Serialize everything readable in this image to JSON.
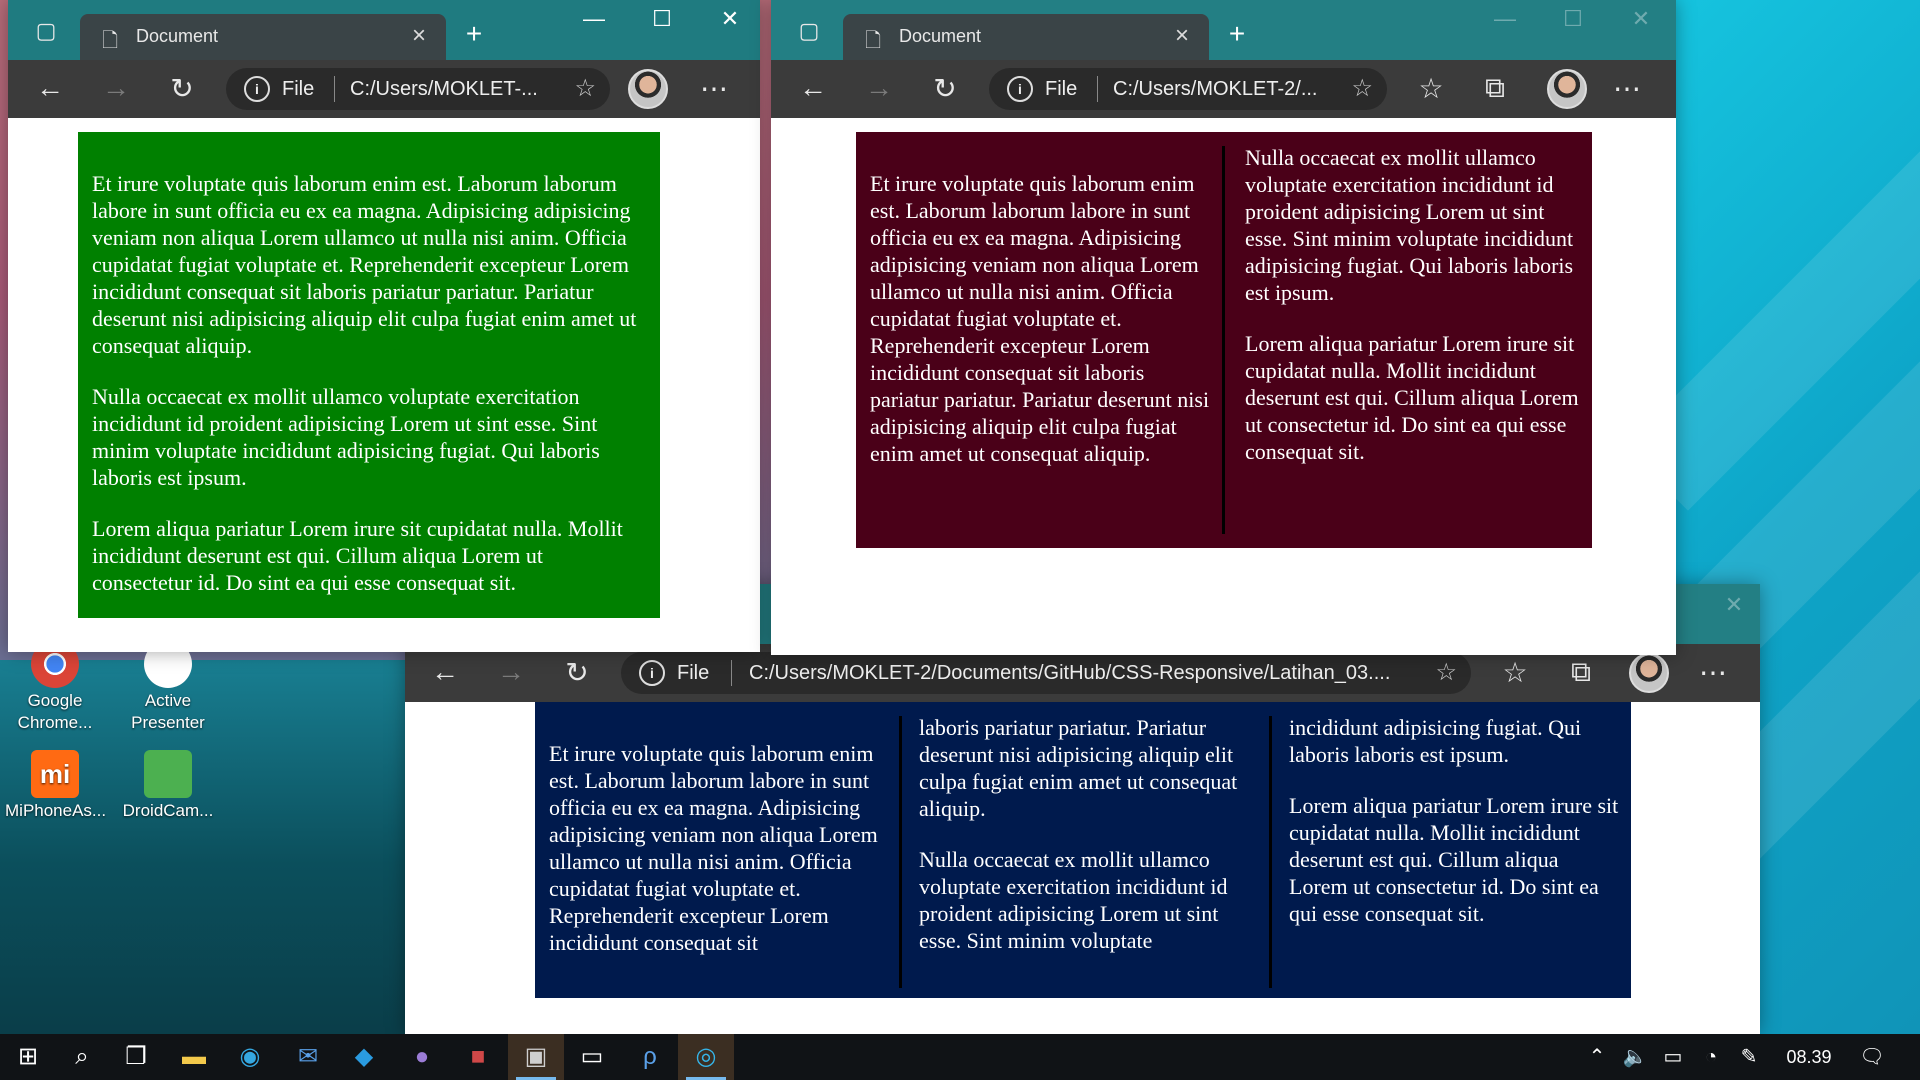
{
  "desktop": {
    "icons": [
      {
        "label": "Google Chrome...",
        "icon": "chrome-shortcut-icon"
      },
      {
        "label": "Active Presenter",
        "icon": "activepresenter-icon"
      },
      {
        "label": "MiPhoneAs...",
        "icon": "mi-icon",
        "color": "#ff6a13"
      },
      {
        "label": "DroidCam...",
        "icon": "droidcam-icon",
        "color": "#4cb050"
      }
    ]
  },
  "windows": [
    {
      "tab_title": "Document",
      "address": {
        "scheme_label": "File",
        "url": "C:/Users/MOKLET-..."
      },
      "box_color": "#008000",
      "paragraphs": [
        "Et irure voluptate quis laborum enim est. Laborum laborum labore in sunt officia eu ex ea magna. Adipisicing adipisicing veniam non aliqua Lorem ullamco ut nulla nisi anim. Officia cupidatat fugiat voluptate et. Reprehenderit excepteur Lorem incididunt consequat sit laboris pariatur pariatur. Pariatur deserunt nisi adipisicing aliquip elit culpa fugiat enim amet ut consequat aliquip.",
        "Nulla occaecat ex mollit ullamco voluptate exercitation incididunt id proident adipisicing Lorem ut sint esse. Sint minim voluptate incididunt adipisicing fugiat. Qui laboris laboris est ipsum.",
        "Lorem aliqua pariatur Lorem irure sit cupidatat nulla. Mollit incididunt deserunt est qui. Cillum aliqua Lorem ut consectetur id. Do sint ea qui esse consequat sit."
      ]
    },
    {
      "tab_title": "Document",
      "address": {
        "scheme_label": "File",
        "url": "C:/Users/MOKLET-2/..."
      },
      "box_color": "#4a0018",
      "columns": [
        [
          "Et irure voluptate quis laborum enim est. Laborum laborum labore in sunt officia eu ex ea magna. Adipisicing adipisicing veniam non aliqua Lorem ullamco ut nulla nisi anim. Officia cupidatat fugiat voluptate et. Reprehenderit excepteur Lorem incididunt consequat sit laboris pariatur pariatur. Pariatur deserunt nisi adipisicing aliquip elit culpa fugiat enim amet ut consequat aliquip."
        ],
        [
          "Nulla occaecat ex mollit ullamco voluptate exercitation incididunt id proident adipisicing Lorem ut sint esse. Sint minim voluptate incididunt adipisicing fugiat. Qui laboris laboris est ipsum.",
          "Lorem aliqua pariatur Lorem irure sit cupidatat nulla. Mollit incididunt deserunt est qui. Cillum aliqua Lorem ut consectetur id. Do sint ea qui esse consequat sit."
        ]
      ]
    },
    {
      "address": {
        "scheme_label": "File",
        "url": "C:/Users/MOKLET-2/Documents/GitHub/CSS-Responsive/Latihan_03...."
      },
      "box_color": "#001a4d",
      "columns": [
        [
          "Et irure voluptate quis laborum enim est. Laborum laborum labore in sunt officia eu ex ea magna. Adipisicing adipisicing veniam non aliqua Lorem ullamco ut nulla nisi anim. Officia cupidatat fugiat voluptate et. Reprehenderit excepteur Lorem incididunt consequat sit"
        ],
        [
          "laboris pariatur pariatur. Pariatur deserunt nisi adipisicing aliquip elit culpa fugiat enim amet ut consequat aliquip.",
          "Nulla occaecat ex mollit ullamco voluptate exercitation incididunt id proident adipisicing Lorem ut sint esse. Sint minim voluptate"
        ],
        [
          "incididunt adipisicing fugiat. Qui laboris laboris est ipsum.",
          "Lorem aliqua pariatur Lorem irure sit cupidatat nulla. Mollit incididunt deserunt est qui. Cillum aliqua Lorem ut consectetur id. Do sint ea qui esse consequat sit."
        ]
      ]
    }
  ],
  "taskbar": {
    "apps": [
      "windows-start-icon",
      "search-icon",
      "task-view-icon",
      "file-explorer-icon",
      "edge-icon",
      "mail-icon",
      "vscode-icon",
      "github-desktop-icon",
      "app-icon",
      "discord-icon",
      "terminal-icon",
      "photoshop-icon",
      "edge-dev-icon"
    ],
    "clock": "08.39"
  }
}
